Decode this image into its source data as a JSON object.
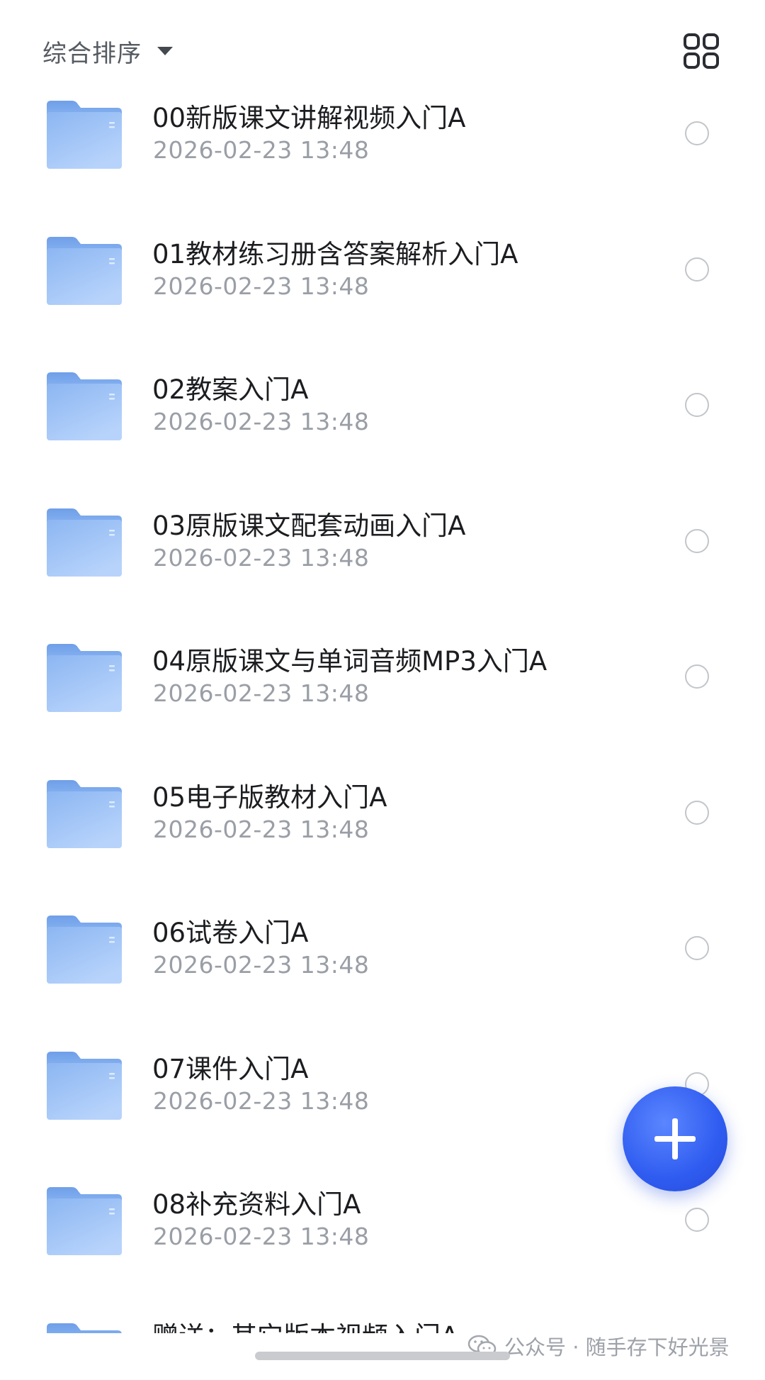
{
  "toolbar": {
    "sort_label": "综合排序",
    "sort_icon": "caret-down-icon",
    "view_icon": "grid-view-icon"
  },
  "files": [
    {
      "name": "00新版课文讲解视频入门A",
      "date": "2026-02-23 13:48"
    },
    {
      "name": "01教材练习册含答案解析入门A",
      "date": "2026-02-23 13:48"
    },
    {
      "name": "02教案入门A",
      "date": "2026-02-23 13:48"
    },
    {
      "name": "03原版课文配套动画入门A",
      "date": "2026-02-23 13:48"
    },
    {
      "name": "04原版课文与单词音频MP3入门A",
      "date": "2026-02-23 13:48"
    },
    {
      "name": "05电子版教材入门A",
      "date": "2026-02-23 13:48"
    },
    {
      "name": "06试卷入门A",
      "date": "2026-02-23 13:48"
    },
    {
      "name": "07课件入门A",
      "date": "2026-02-23 13:48"
    },
    {
      "name": "08补充资料入门A",
      "date": "2026-02-23 13:48"
    },
    {
      "name": "赠送：其它版本视频入门A",
      "date": ""
    }
  ],
  "fab": {
    "icon": "plus-icon"
  },
  "watermark": {
    "icon": "wechat-icon",
    "text": "公众号 · 随手存下好光景"
  },
  "colors": {
    "folder_blue": "#8fb9f3",
    "fab_blue": "#2f5cf0",
    "title_text": "#1c1d20",
    "date_text": "#9a9ea6"
  }
}
